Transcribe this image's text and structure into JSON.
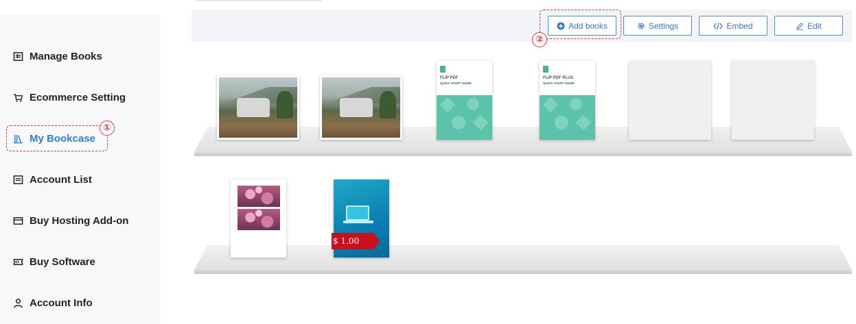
{
  "sidebar": {
    "items": [
      {
        "label": "Manage Books",
        "icon": "manage-books-icon"
      },
      {
        "label": "Ecommerce Setting",
        "icon": "cart-icon"
      },
      {
        "label": "My Bookcase",
        "icon": "bookcase-icon",
        "active": true
      },
      {
        "label": "Account List",
        "icon": "account-list-icon"
      },
      {
        "label": "Buy Hosting Add-on",
        "icon": "hosting-icon"
      },
      {
        "label": "Buy Software",
        "icon": "software-icon"
      },
      {
        "label": "Account Info",
        "icon": "user-icon"
      }
    ]
  },
  "annotations": {
    "one": "①",
    "two": "②",
    "color": "#d9363e"
  },
  "toolbar": {
    "add_books": "Add books",
    "settings": "Settings",
    "embed": "Embed",
    "edit": "Edit"
  },
  "books": {
    "flip1_title": "FLIP PDF",
    "flip1_sub": "QUICK START GUIDE",
    "flip2_title": "FLIP PDF PLUS",
    "flip2_sub": "QUICK START GUIDE",
    "price": "$ 1.00"
  },
  "colors": {
    "accent": "#2f7fd6",
    "button_border": "#4a90d9",
    "price_tag": "#c8101e",
    "flip_green": "#5ac3a9"
  }
}
